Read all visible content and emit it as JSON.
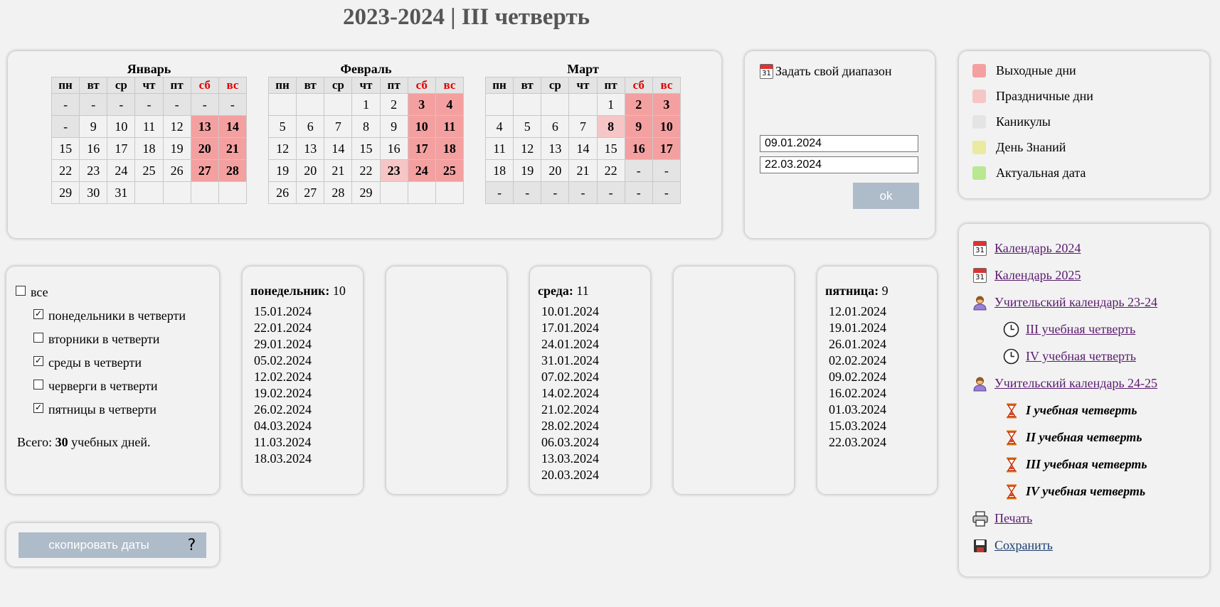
{
  "title": "2023-2024 | III четверть",
  "weekday_headers": [
    "пн",
    "вт",
    "ср",
    "чт",
    "пт",
    "сб",
    "вс"
  ],
  "colors": {
    "weekend": "#f4a0a0",
    "holiday": "#f6c5c5",
    "vacation": "#e4e4e4",
    "knowledge_day": "#eaeaa0",
    "current_date": "#b8e890",
    "button": "#aebbc9"
  },
  "months": [
    {
      "name": "Январь",
      "weeks": [
        [
          {
            "t": "-",
            "k": "vac"
          },
          {
            "t": "-",
            "k": "vac"
          },
          {
            "t": "-",
            "k": "vac"
          },
          {
            "t": "-",
            "k": "vac"
          },
          {
            "t": "-",
            "k": "vac"
          },
          {
            "t": "-",
            "k": "vac"
          },
          {
            "t": "-",
            "k": "vac"
          }
        ],
        [
          {
            "t": "-",
            "k": "vac"
          },
          {
            "t": "9"
          },
          {
            "t": "10"
          },
          {
            "t": "11"
          },
          {
            "t": "12"
          },
          {
            "t": "13",
            "k": "weekend"
          },
          {
            "t": "14",
            "k": "weekend"
          }
        ],
        [
          {
            "t": "15"
          },
          {
            "t": "16"
          },
          {
            "t": "17"
          },
          {
            "t": "18"
          },
          {
            "t": "19"
          },
          {
            "t": "20",
            "k": "weekend"
          },
          {
            "t": "21",
            "k": "weekend"
          }
        ],
        [
          {
            "t": "22"
          },
          {
            "t": "23"
          },
          {
            "t": "24"
          },
          {
            "t": "25"
          },
          {
            "t": "26"
          },
          {
            "t": "27",
            "k": "weekend"
          },
          {
            "t": "28",
            "k": "weekend"
          }
        ],
        [
          {
            "t": "29"
          },
          {
            "t": "30"
          },
          {
            "t": "31"
          },
          {
            "t": ""
          },
          {
            "t": ""
          },
          {
            "t": ""
          },
          {
            "t": ""
          }
        ]
      ]
    },
    {
      "name": "Февраль",
      "weeks": [
        [
          {
            "t": ""
          },
          {
            "t": ""
          },
          {
            "t": ""
          },
          {
            "t": "1"
          },
          {
            "t": "2"
          },
          {
            "t": "3",
            "k": "weekend"
          },
          {
            "t": "4",
            "k": "weekend"
          }
        ],
        [
          {
            "t": "5"
          },
          {
            "t": "6"
          },
          {
            "t": "7"
          },
          {
            "t": "8"
          },
          {
            "t": "9"
          },
          {
            "t": "10",
            "k": "weekend"
          },
          {
            "t": "11",
            "k": "weekend"
          }
        ],
        [
          {
            "t": "12"
          },
          {
            "t": "13"
          },
          {
            "t": "14"
          },
          {
            "t": "15"
          },
          {
            "t": "16"
          },
          {
            "t": "17",
            "k": "weekend"
          },
          {
            "t": "18",
            "k": "weekend"
          }
        ],
        [
          {
            "t": "19"
          },
          {
            "t": "20"
          },
          {
            "t": "21"
          },
          {
            "t": "22"
          },
          {
            "t": "23",
            "k": "holiday"
          },
          {
            "t": "24",
            "k": "weekend"
          },
          {
            "t": "25",
            "k": "weekend"
          }
        ],
        [
          {
            "t": "26"
          },
          {
            "t": "27"
          },
          {
            "t": "28"
          },
          {
            "t": "29"
          },
          {
            "t": ""
          },
          {
            "t": ""
          },
          {
            "t": ""
          }
        ]
      ]
    },
    {
      "name": "Март",
      "weeks": [
        [
          {
            "t": ""
          },
          {
            "t": ""
          },
          {
            "t": ""
          },
          {
            "t": ""
          },
          {
            "t": "1"
          },
          {
            "t": "2",
            "k": "weekend"
          },
          {
            "t": "3",
            "k": "weekend"
          }
        ],
        [
          {
            "t": "4"
          },
          {
            "t": "5"
          },
          {
            "t": "6"
          },
          {
            "t": "7"
          },
          {
            "t": "8",
            "k": "holiday"
          },
          {
            "t": "9",
            "k": "weekend"
          },
          {
            "t": "10",
            "k": "weekend"
          }
        ],
        [
          {
            "t": "11"
          },
          {
            "t": "12"
          },
          {
            "t": "13"
          },
          {
            "t": "14"
          },
          {
            "t": "15"
          },
          {
            "t": "16",
            "k": "weekend"
          },
          {
            "t": "17",
            "k": "weekend"
          }
        ],
        [
          {
            "t": "18"
          },
          {
            "t": "19"
          },
          {
            "t": "20"
          },
          {
            "t": "21"
          },
          {
            "t": "22"
          },
          {
            "t": "-",
            "k": "vac"
          },
          {
            "t": "-",
            "k": "vac"
          }
        ],
        [
          {
            "t": "-",
            "k": "vac"
          },
          {
            "t": "-",
            "k": "vac"
          },
          {
            "t": "-",
            "k": "vac"
          },
          {
            "t": "-",
            "k": "vac"
          },
          {
            "t": "-",
            "k": "vac"
          },
          {
            "t": "-",
            "k": "vac"
          },
          {
            "t": "-",
            "k": "vac"
          }
        ]
      ]
    }
  ],
  "range": {
    "title": "Задать свой диапазон",
    "icon_day": "31",
    "from": "09.01.2024",
    "to": "22.03.2024",
    "ok_label": "ok"
  },
  "legend": [
    {
      "label": "Выходные дни",
      "color": "#f4a0a0"
    },
    {
      "label": "Праздничные дни",
      "color": "#f6c5c5"
    },
    {
      "label": "Каникулы",
      "color": "#e4e4e4"
    },
    {
      "label": "День Знаний",
      "color": "#eaeaa0"
    },
    {
      "label": "Актуальная дата",
      "color": "#b8e890"
    }
  ],
  "checkboxes": {
    "all": {
      "label": "все",
      "checked": false
    },
    "items": [
      {
        "label": "понедельники в четверти",
        "checked": true
      },
      {
        "label": "вторники в четверти",
        "checked": false
      },
      {
        "label": "среды в четверти",
        "checked": true
      },
      {
        "label": "черверги в четверти",
        "checked": false
      },
      {
        "label": "пятницы в четверти",
        "checked": true
      }
    ],
    "total_prefix": "Всего: ",
    "total_value": "30",
    "total_suffix": " учебных дней."
  },
  "day_columns": [
    {
      "day": "понедельник:",
      "count": "10",
      "dates": [
        "15.01.2024",
        "22.01.2024",
        "29.01.2024",
        "05.02.2024",
        "12.02.2024",
        "19.02.2024",
        "26.02.2024",
        "04.03.2024",
        "11.03.2024",
        "18.03.2024"
      ]
    },
    {
      "day": "",
      "count": "",
      "dates": []
    },
    {
      "day": "среда:",
      "count": "11",
      "dates": [
        "10.01.2024",
        "17.01.2024",
        "24.01.2024",
        "31.01.2024",
        "07.02.2024",
        "14.02.2024",
        "21.02.2024",
        "28.02.2024",
        "06.03.2024",
        "13.03.2024",
        "20.03.2024"
      ]
    },
    {
      "day": "",
      "count": "",
      "dates": []
    },
    {
      "day": "пятница:",
      "count": "9",
      "dates": [
        "12.01.2024",
        "19.01.2024",
        "26.01.2024",
        "02.02.2024",
        "09.02.2024",
        "16.02.2024",
        "01.03.2024",
        "15.03.2024",
        "22.03.2024"
      ]
    }
  ],
  "copy_button": "скопировать даты",
  "help_button": "?",
  "links": {
    "calendar_2024": "Календарь 2024",
    "calendar_2025": "Календарь 2025",
    "teacher_23_24": "Учительский календарь 23-24",
    "q3_link": "III учебная четверть",
    "q4_link": "IV учебная четверть",
    "teacher_24_25": "Учительский календарь 24-25",
    "q1_b": "I учебная четверть",
    "q2_b": "II учебная четверть",
    "q3_b": "III учебная четверть",
    "q4_b": "IV учебная четверть",
    "print": "Печать",
    "save": "Сохранить",
    "calendar_icon_day": "31"
  }
}
